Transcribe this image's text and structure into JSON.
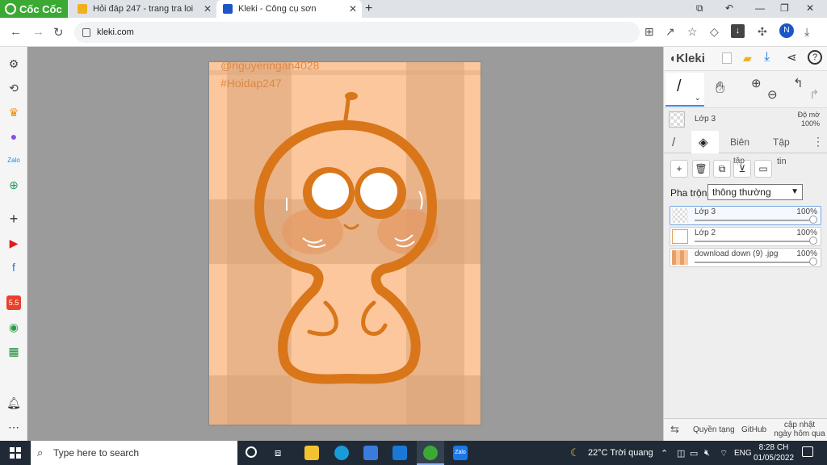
{
  "browser": {
    "brand": "Cốc Cốc",
    "tabs": [
      {
        "title": "Hỏi đáp 247 - trang tra loi",
        "favicon_color": "#f2b01e"
      },
      {
        "title": "Kleki - Công cụ sơn",
        "favicon_color": "#1a56c8",
        "active": true
      }
    ],
    "url": "kleki.com",
    "profile_initial": "N"
  },
  "sidebar": {
    "icons": [
      "settings-icon",
      "history-icon",
      "crown-icon",
      "messenger-icon",
      "zalo-icon",
      "gamepad-icon",
      "add-icon",
      "youtube-icon",
      "facebook-icon",
      "app-icon",
      "maps-icon",
      "sheets-icon",
      "notifications-icon",
      "more-icon"
    ]
  },
  "artwork": {
    "watermark_user": "@nguyenngan4028",
    "watermark_tag": "#Hoidap247",
    "colors": {
      "bg": "#fcc79c",
      "stripe": "#d9a47a",
      "line": "#d9761a",
      "blush": "#e8945a"
    }
  },
  "kleki": {
    "logo": "Kleki",
    "layer_info": {
      "name": "Lớp 3",
      "opacity_label": "Độ mờ",
      "opacity": "100%"
    },
    "tabs": {
      "edit": "Biên",
      "file": "Tập",
      "tin": "tin",
      "tap_small": "tập"
    },
    "blend": {
      "label": "Pha trộn",
      "value": "thông thường"
    },
    "layers": [
      {
        "name": "Lớp 3",
        "opacity": "100%",
        "selected": true
      },
      {
        "name": "Lớp 2",
        "opacity": "100%"
      },
      {
        "name": "download down (9) .jpg",
        "opacity": "100%"
      }
    ],
    "footer": {
      "rights": "Quyền tạng",
      "github": "GitHub",
      "update_line1": "cập nhật",
      "update_line2": "ngày hôm qua"
    }
  },
  "taskbar": {
    "search_placeholder": "Type here to search",
    "weather": "22°C  Trời quang",
    "lang": "ENG",
    "time": "8:28 CH",
    "date": "01/05/2022"
  }
}
